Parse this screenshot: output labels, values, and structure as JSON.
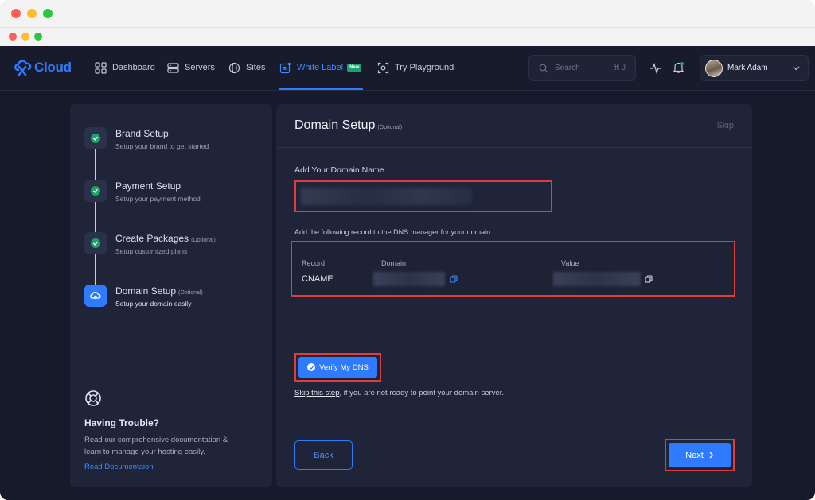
{
  "nav": {
    "logo_text": "Cloud",
    "items": [
      {
        "label": "Dashboard",
        "icon": "dashboard-icon"
      },
      {
        "label": "Servers",
        "icon": "servers-icon"
      },
      {
        "label": "Sites",
        "icon": "globe-icon"
      },
      {
        "label": "White Label",
        "icon": "white-label-icon",
        "badge": "New",
        "active": true
      },
      {
        "label": "Try Playground",
        "icon": "playground-icon"
      }
    ],
    "search_placeholder": "Search",
    "search_shortcut": "⌘ J",
    "user_name": "Mark Adam"
  },
  "steps": [
    {
      "title": "Brand Setup",
      "subtitle": "Setup your brand to get started",
      "done": true
    },
    {
      "title": "Payment Setup",
      "subtitle": "Setup your payment method",
      "done": true
    },
    {
      "title": "Create Packages",
      "optional": "(Optional)",
      "subtitle": "Setup customized plans",
      "done": true
    },
    {
      "title": "Domain Setup",
      "optional": "(Optional)",
      "subtitle": "Setup your domain easily",
      "active": true
    }
  ],
  "help": {
    "title": "Having Trouble?",
    "text": "Read our comprehensive documentation & learn to manage your hosting easily.",
    "link": "Read Documentaion"
  },
  "main": {
    "title": "Domain Setup",
    "title_optional": "(Optional)",
    "skip": "Skip",
    "domain_label": "Add Your Domain Name",
    "dns_instruction": "Add the following record to the DNS manager for your domain",
    "dns": {
      "record_header": "Record",
      "record_value": "CNAME",
      "domain_header": "Domain",
      "value_header": "Value"
    },
    "verify_label": "Verify My DNS",
    "skip_step_link": "Skip this step",
    "skip_step_rest": ", if you are not ready to point your domain server.",
    "back_label": "Back",
    "next_label": "Next"
  },
  "colors": {
    "accent": "#2f7bff",
    "success": "#1aa36a",
    "highlight": "#e23b3b"
  }
}
